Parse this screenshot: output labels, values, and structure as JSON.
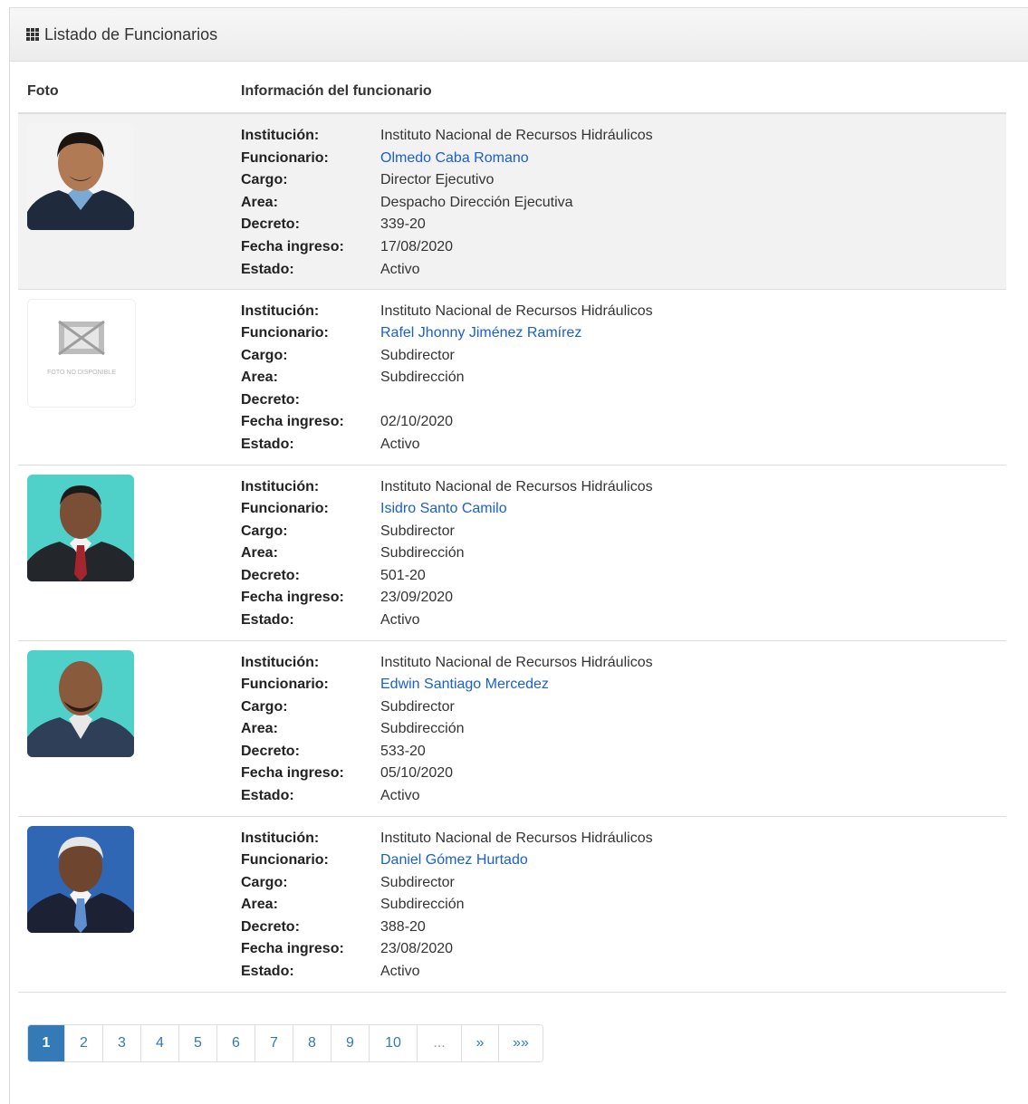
{
  "panel": {
    "title": "Listado de Funcionarios",
    "icon": "grid-icon"
  },
  "table": {
    "headers": [
      "Foto",
      "Información del funcionario"
    ],
    "labels": {
      "institucion": "Institución:",
      "funcionario": "Funcionario:",
      "cargo": "Cargo:",
      "area": "Area:",
      "decreto": "Decreto:",
      "fecha": "Fecha ingreso:",
      "estado": "Estado:"
    },
    "rows": [
      {
        "institucion": "Instituto Nacional de Recursos Hidráulicos",
        "funcionario": "Olmedo Caba Romano",
        "cargo": "Director Ejecutivo",
        "area": "Despacho Dirección Ejecutiva",
        "decreto": "339-20",
        "fecha": "17/08/2020",
        "estado": "Activo"
      },
      {
        "institucion": "Instituto Nacional de Recursos Hidráulicos",
        "funcionario": "Rafel Jhonny Jiménez Ramírez",
        "cargo": "Subdirector",
        "area": "Subdirección",
        "decreto": "",
        "fecha": "02/10/2020",
        "estado": "Activo",
        "no_photo_text": "FOTO NO DISPONIBLE"
      },
      {
        "institucion": "Instituto Nacional de Recursos Hidráulicos",
        "funcionario": "Isidro Santo Camilo",
        "cargo": "Subdirector",
        "area": "Subdirección",
        "decreto": "501-20",
        "fecha": "23/09/2020",
        "estado": "Activo"
      },
      {
        "institucion": "Instituto Nacional de Recursos Hidráulicos",
        "funcionario": "Edwin Santiago Mercedez",
        "cargo": "Subdirector",
        "area": "Subdirección",
        "decreto": "533-20",
        "fecha": "05/10/2020",
        "estado": "Activo"
      },
      {
        "institucion": "Instituto Nacional de Recursos Hidráulicos",
        "funcionario": "Daniel Gómez Hurtado",
        "cargo": "Subdirector",
        "area": "Subdirección",
        "decreto": "388-20",
        "fecha": "23/08/2020",
        "estado": "Activo"
      }
    ]
  },
  "pagination": {
    "pages": [
      "1",
      "2",
      "3",
      "4",
      "5",
      "6",
      "7",
      "8",
      "9",
      "10"
    ],
    "current": "1",
    "ellipsis": "...",
    "next": "»",
    "last": "»»"
  },
  "colors": {
    "link": "#1a5fd1",
    "active_page": "#337ab7"
  }
}
